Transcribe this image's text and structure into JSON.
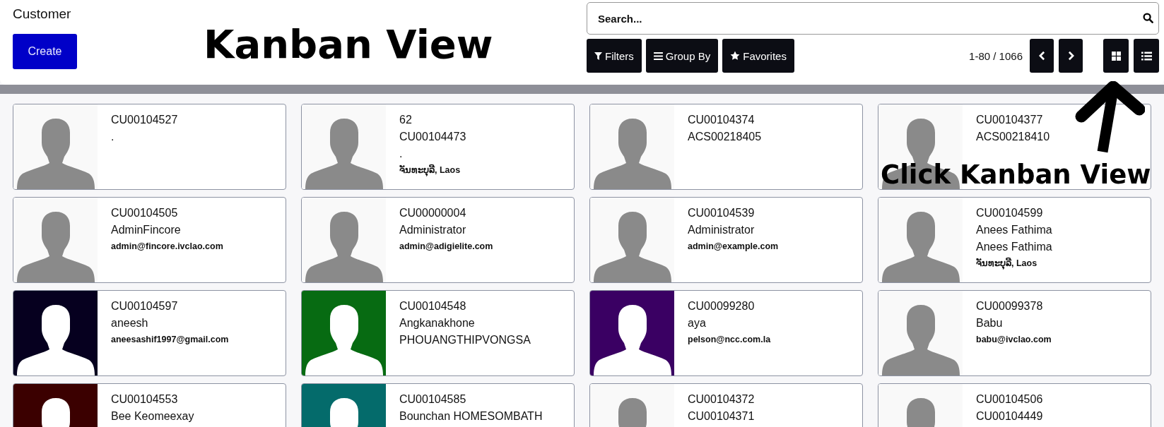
{
  "header": {
    "title": "Customer",
    "create_button": "Create",
    "search": {
      "placeholder": "Search..."
    },
    "filters": [
      {
        "label": "Filters",
        "kind": "filter"
      },
      {
        "label": "Group By",
        "kind": "group"
      },
      {
        "label": "Favorites",
        "kind": "star"
      }
    ],
    "pager": "1-80 / 1066",
    "views": [
      {
        "kind": "kanban"
      },
      {
        "kind": "list"
      }
    ]
  },
  "annotations": [
    {
      "kind": "title",
      "text": "Kanban View"
    },
    {
      "kind": "hint",
      "text": "Click Kanban View"
    }
  ],
  "cards": [
    {
      "lines": [
        {
          "kind": "main",
          "text": "CU00104527"
        },
        {
          "kind": "main",
          "text": "."
        }
      ]
    },
    {
      "lines": [
        {
          "kind": "main",
          "text": "62"
        },
        {
          "kind": "main",
          "text": "CU00104473"
        },
        {
          "kind": "main",
          "text": "."
        },
        {
          "kind": "detail",
          "text": "ຈັນທະບຸລີ, Laos"
        }
      ]
    },
    {
      "lines": [
        {
          "kind": "main",
          "text": "CU00104374"
        },
        {
          "kind": "main",
          "text": "ACS00218405"
        }
      ]
    },
    {
      "lines": [
        {
          "kind": "main",
          "text": "CU00104377"
        },
        {
          "kind": "main",
          "text": "ACS00218410"
        }
      ]
    },
    {
      "lines": [
        {
          "kind": "main",
          "text": "CU00104505"
        },
        {
          "kind": "main",
          "text": "AdminFincore"
        },
        {
          "kind": "detail",
          "text": "admin@fincore.ivclao.com"
        }
      ]
    },
    {
      "lines": [
        {
          "kind": "main",
          "text": "CU00000004"
        },
        {
          "kind": "main",
          "text": "Administrator"
        },
        {
          "kind": "detail",
          "text": "admin@adigielite.com"
        }
      ]
    },
    {
      "lines": [
        {
          "kind": "main",
          "text": "CU00104539"
        },
        {
          "kind": "main",
          "text": "Administrator"
        },
        {
          "kind": "detail",
          "text": "admin@example.com"
        }
      ]
    },
    {
      "lines": [
        {
          "kind": "main",
          "text": "CU00104599"
        },
        {
          "kind": "main",
          "text": "Anees Fathima"
        },
        {
          "kind": "main",
          "text": "Anees Fathima"
        },
        {
          "kind": "detail",
          "text": "ຈັນທະບຸລີ, Laos"
        }
      ]
    },
    {
      "color": "#06001f",
      "lines": [
        {
          "kind": "main",
          "text": "CU00104597"
        },
        {
          "kind": "main",
          "text": "aneesh"
        },
        {
          "kind": "detail",
          "text": "aneesashif1997@gmail.com"
        }
      ]
    },
    {
      "color": "#076b12",
      "lines": [
        {
          "kind": "main",
          "text": "CU00104548"
        },
        {
          "kind": "main",
          "text": "Angkanakhone PHOUANGTHIPVONGSA"
        }
      ]
    },
    {
      "color": "#3a0063",
      "lines": [
        {
          "kind": "main",
          "text": "CU00099280"
        },
        {
          "kind": "main",
          "text": "aya"
        },
        {
          "kind": "detail",
          "text": "pelson@ncc.com.la"
        }
      ]
    },
    {
      "lines": [
        {
          "kind": "main",
          "text": "CU00099378"
        },
        {
          "kind": "main",
          "text": "Babu"
        },
        {
          "kind": "detail",
          "text": "babu@ivclao.com"
        }
      ]
    },
    {
      "color": "#3b0000",
      "lines": [
        {
          "kind": "main",
          "text": "CU00104553"
        },
        {
          "kind": "main",
          "text": "Bee Keomeexay"
        }
      ]
    },
    {
      "color": "#046b6b",
      "lines": [
        {
          "kind": "main",
          "text": "CU00104585"
        },
        {
          "kind": "main",
          "text": "Bounchan HOMESOMBATH"
        }
      ]
    },
    {
      "lines": [
        {
          "kind": "main",
          "text": "CU00104372"
        },
        {
          "kind": "main",
          "text": "CU00104371"
        }
      ]
    },
    {
      "lines": [
        {
          "kind": "main",
          "text": "CU00104506"
        },
        {
          "kind": "main",
          "text": "CU00104449"
        }
      ]
    }
  ]
}
